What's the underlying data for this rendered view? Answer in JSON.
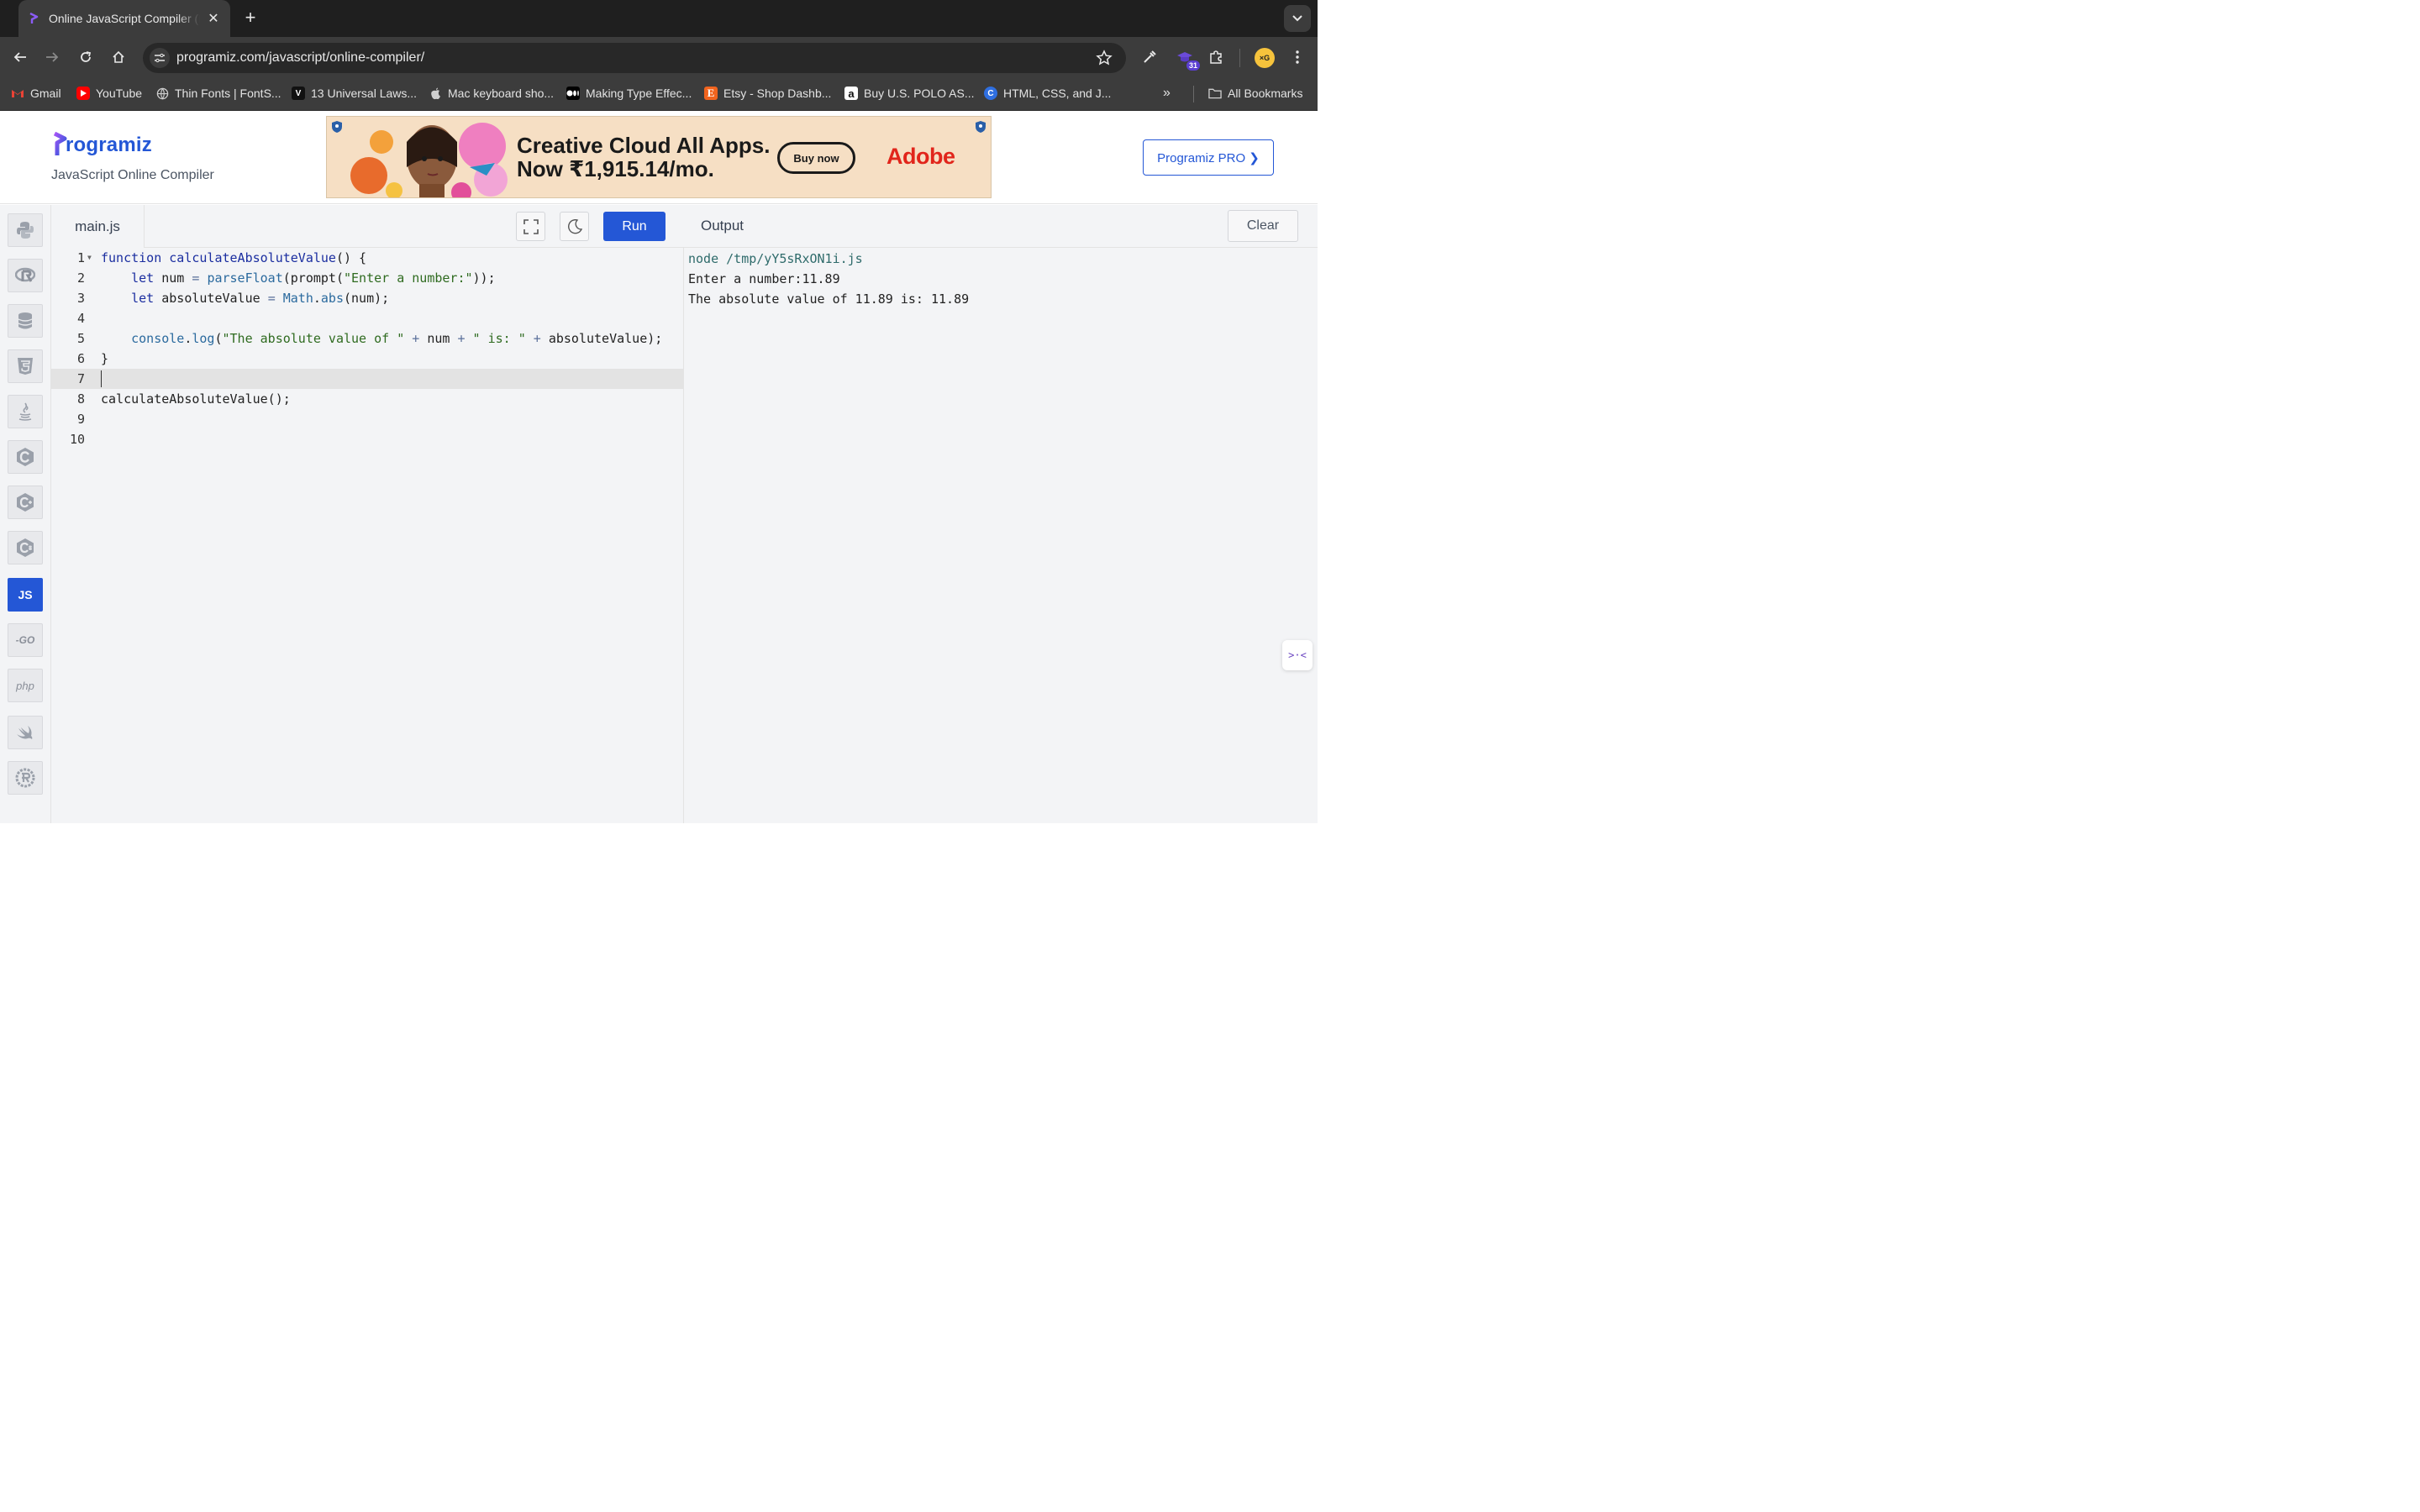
{
  "browser": {
    "tab_title": "Online JavaScript Compiler (Editor)",
    "tab_close": "✕",
    "new_tab": "+",
    "url": "programiz.com/javascript/online-compiler/",
    "extension_badge": "31",
    "bookmarks": [
      {
        "label": "Gmail",
        "icon": "gmail-icon"
      },
      {
        "label": "YouTube",
        "icon": "youtube-icon"
      },
      {
        "label": "Thin Fonts | FontS...",
        "icon": "globe-icon"
      },
      {
        "label": "13 Universal Laws...",
        "icon": "brand-v-icon"
      },
      {
        "label": "Mac keyboard sho...",
        "icon": "apple-icon"
      },
      {
        "label": "Making Type Effec...",
        "icon": "medium-icon"
      },
      {
        "label": "Etsy - Shop Dashb...",
        "icon": "etsy-icon"
      },
      {
        "label": "Buy U.S. POLO AS...",
        "icon": "amazon-icon"
      },
      {
        "label": "HTML, CSS, and J...",
        "icon": "c-icon"
      }
    ],
    "bookmarks_more": "»",
    "all_bookmarks": "All Bookmarks"
  },
  "header": {
    "logo_text": "rogramiz",
    "subtitle": "JavaScript Online Compiler",
    "ad": {
      "headline_1": "Creative Cloud All Apps.",
      "headline_2": "Now ₹1,915.14/mo.",
      "cta": "Buy now",
      "brand": "Adobe"
    },
    "pro_button": "Programiz PRO ❯"
  },
  "languages": [
    {
      "name": "python",
      "icon": "python-icon"
    },
    {
      "name": "r",
      "icon": "r-icon"
    },
    {
      "name": "sql",
      "icon": "database-icon"
    },
    {
      "name": "html",
      "icon": "html5-icon"
    },
    {
      "name": "java",
      "icon": "java-icon"
    },
    {
      "name": "c",
      "icon": "c-icon"
    },
    {
      "name": "cpp",
      "icon": "cpp-icon"
    },
    {
      "name": "csharp",
      "icon": "csharp-icon"
    },
    {
      "name": "javascript",
      "label": "JS",
      "active": true
    },
    {
      "name": "go",
      "label": "-GO"
    },
    {
      "name": "php",
      "label": "php"
    },
    {
      "name": "swift",
      "icon": "swift-icon"
    },
    {
      "name": "rust",
      "icon": "rust-icon"
    }
  ],
  "editor": {
    "filename": "main.js",
    "run_label": "Run",
    "active_line": 7,
    "line_numbers": [
      "1",
      "2",
      "3",
      "4",
      "5",
      "6",
      "7",
      "8",
      "9",
      "10"
    ]
  },
  "output": {
    "title": "Output",
    "clear_label": "Clear",
    "lines": [
      "node /tmp/yY5sRxON1i.js",
      "Enter a number:11.89",
      "The absolute value of 11.89 is: 11.89"
    ]
  },
  "colors": {
    "brand_blue": "#2457d6",
    "ad_red": "#e1251b"
  }
}
